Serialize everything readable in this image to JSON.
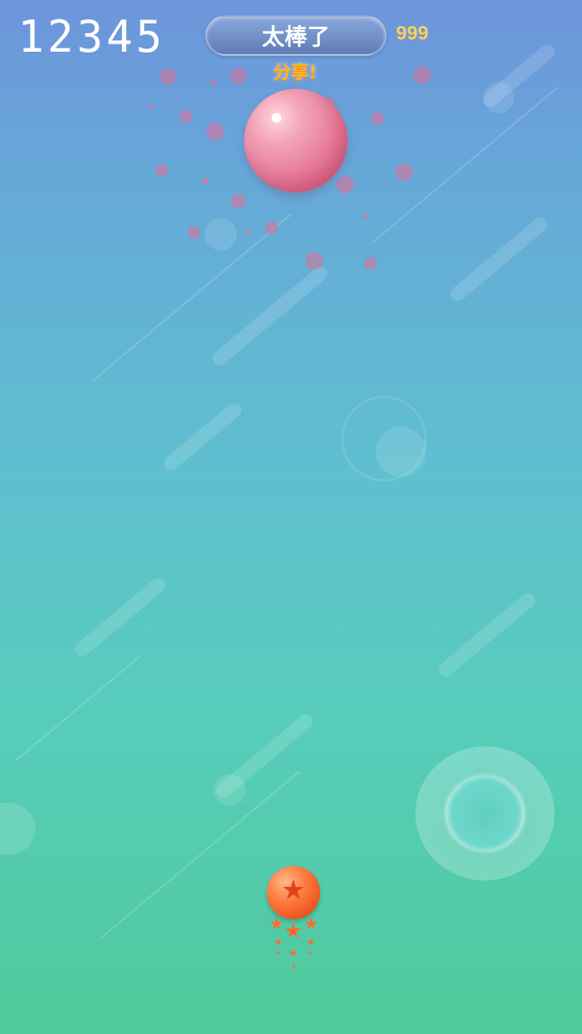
{
  "hud": {
    "score": "12345",
    "banner_text": "太棒了",
    "coins": "999",
    "share_label": "分享!"
  },
  "colors": {
    "bg_top": "#6d95dc",
    "bg_bottom": "#50c99b",
    "coin_text": "#f8d162",
    "share_text": "#ffb326",
    "target_ball": "#e57996",
    "player_ball": "#ff7a3d"
  },
  "icons": {
    "player_star": "★",
    "trail_star": "★"
  }
}
